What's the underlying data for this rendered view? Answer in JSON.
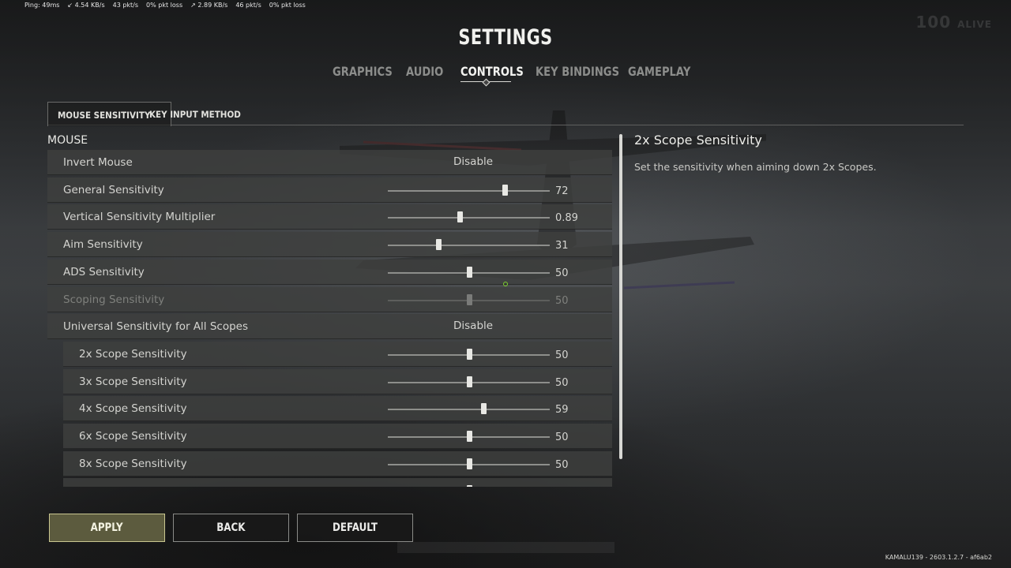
{
  "netstats": {
    "ping": "Ping: 49ms",
    "down_rate": "4.54 KB/s",
    "down_pkts": "43 pkt/s",
    "down_loss": "0% pkt loss",
    "up_rate": "2.89 KB/s",
    "up_pkts": "46 pkt/s",
    "up_loss": "0% pkt loss"
  },
  "alive": {
    "count": "100",
    "label": "ALIVE"
  },
  "title": "SETTINGS",
  "tabs": [
    "GRAPHICS",
    "AUDIO",
    "CONTROLS",
    "KEY BINDINGS",
    "GAMEPLAY"
  ],
  "active_tab": "CONTROLS",
  "subtabs": [
    "MOUSE SENSITIVITY",
    "KEY INPUT METHOD"
  ],
  "active_subtab": "MOUSE SENSITIVITY",
  "section_label": "MOUSE",
  "rows": [
    {
      "label": "Invert Mouse",
      "type": "toggle",
      "value": "Disable"
    },
    {
      "label": "General Sensitivity",
      "type": "slider",
      "value": "72",
      "level": 0.72
    },
    {
      "label": "Vertical Sensitivity Multiplier",
      "type": "slider",
      "value": "0.89",
      "level": 0.445
    },
    {
      "label": "Aim Sensitivity",
      "type": "slider",
      "value": "31",
      "level": 0.31
    },
    {
      "label": "ADS Sensitivity",
      "type": "slider",
      "value": "50",
      "level": 0.5
    },
    {
      "label": "Scoping Sensitivity",
      "type": "slider",
      "value": "50",
      "level": 0.5,
      "disabled": true
    },
    {
      "label": "Universal Sensitivity for All Scopes",
      "type": "toggle",
      "value": "Disable"
    },
    {
      "label": "2x Scope Sensitivity",
      "type": "slider",
      "value": "50",
      "level": 0.5,
      "sub": true
    },
    {
      "label": "3x Scope Sensitivity",
      "type": "slider",
      "value": "50",
      "level": 0.5,
      "sub": true
    },
    {
      "label": "4x Scope Sensitivity",
      "type": "slider",
      "value": "59",
      "level": 0.59,
      "sub": true
    },
    {
      "label": "6x Scope Sensitivity",
      "type": "slider",
      "value": "50",
      "level": 0.5,
      "sub": true
    },
    {
      "label": "8x Scope Sensitivity",
      "type": "slider",
      "value": "50",
      "level": 0.5,
      "sub": true
    },
    {
      "label": "",
      "type": "slider",
      "value": "",
      "level": 0.5,
      "sub": true
    }
  ],
  "help": {
    "title": "2x Scope Sensitivity",
    "description": "Set the sensitivity when aiming down 2x Scopes."
  },
  "buttons": {
    "apply": "APPLY",
    "back": "BACK",
    "default": "DEFAULT"
  },
  "version": "KAMALU139 - 2603.1.2.7 - af6ab2"
}
